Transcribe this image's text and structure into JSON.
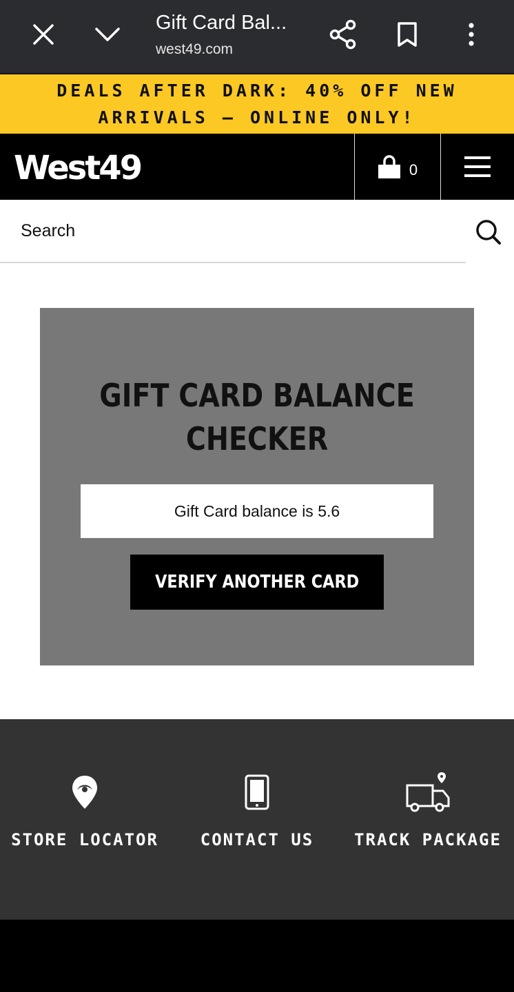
{
  "browser": {
    "title": "Gift Card Bal...",
    "url": "west49.com",
    "close_icon": "close-icon",
    "tabs_icon": "chevron-down-icon",
    "share_icon": "share-icon",
    "bookmark_icon": "bookmark-icon",
    "more_icon": "more-vert-icon"
  },
  "promo": {
    "text": "DEALS AFTER DARK: 40% OFF NEW ARRIVALS — ONLINE ONLY!",
    "background": "#fcc824"
  },
  "header": {
    "logo_text": "West49",
    "cart_count": "0",
    "cart_icon": "shopping-bag-icon",
    "menu_icon": "hamburger-menu-icon"
  },
  "search": {
    "placeholder": "Search",
    "icon": "search-icon"
  },
  "gift_card": {
    "title": "GIFT CARD BALANCE CHECKER",
    "result": "Gift Card balance is 5.6",
    "button_label": "VERIFY ANOTHER CARD"
  },
  "footer": {
    "items": [
      {
        "label": "STORE LOCATOR",
        "icon": "location-pin-icon"
      },
      {
        "label": "CONTACT US",
        "icon": "smartphone-icon"
      },
      {
        "label": "TRACK PACKAGE",
        "icon": "delivery-truck-icon"
      }
    ]
  }
}
